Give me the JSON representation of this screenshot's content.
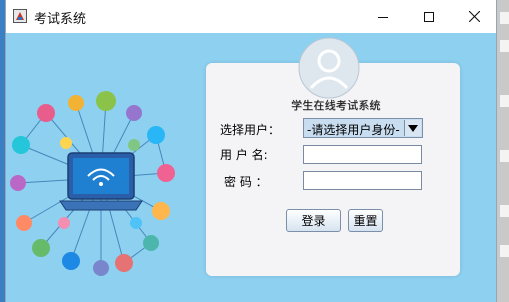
{
  "window": {
    "title": "考试系统",
    "controls": {
      "minimize_icon": "minimize-icon",
      "maximize_icon": "maximize-icon",
      "close_icon": "close-icon"
    }
  },
  "login": {
    "subtitle": "学生在线考试系统",
    "role_label": "选择用户：",
    "role_selected": "-请选择用户身份-",
    "username_label": "用 户 名:",
    "username_value": "",
    "password_label": "密  码 ：",
    "password_value": "",
    "login_button": "登录",
    "reset_button": "重置"
  },
  "colors": {
    "client_background": "#8dd0f0",
    "card_background": "#f4f4f6",
    "select_background": "#c9ddf1"
  },
  "icons": [
    "app-icon",
    "user-avatar-icon",
    "network-illustration-icon",
    "laptop-wifi-icon",
    "dropdown-arrow-icon"
  ]
}
